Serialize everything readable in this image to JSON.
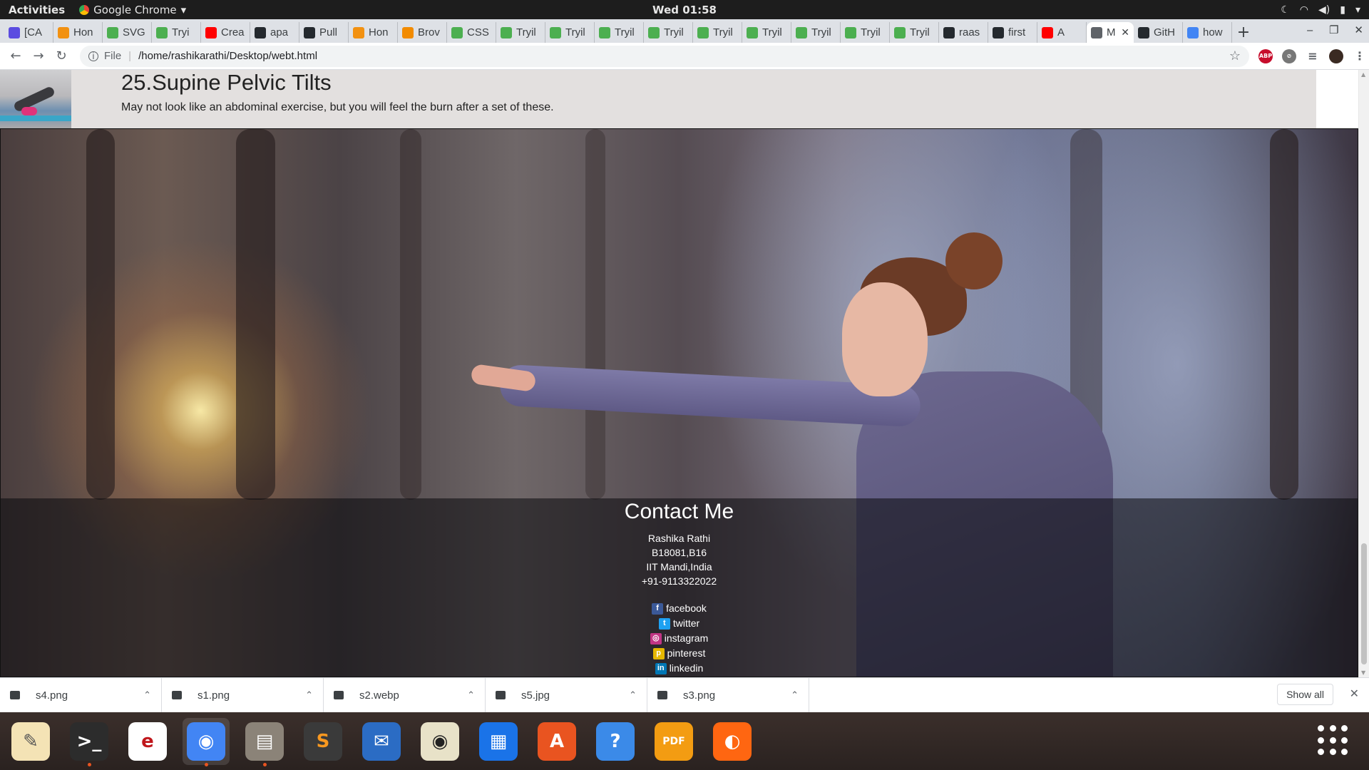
{
  "topbar": {
    "activities": "Activities",
    "app_name": "Google Chrome",
    "clock": "Wed 01:58"
  },
  "tabs": [
    {
      "label": "[CA",
      "favicon": "diamond-icon",
      "color": "#5b4ce0"
    },
    {
      "label": "Hon",
      "favicon": "swirl-icon",
      "color": "#f29111"
    },
    {
      "label": "SVG",
      "favicon": "w3schools-icon",
      "color": "#4caf50"
    },
    {
      "label": "Tryi",
      "favicon": "w3schools-icon",
      "color": "#4caf50"
    },
    {
      "label": "Crea",
      "favicon": "youtube-icon",
      "color": "#ff0000"
    },
    {
      "label": "apa",
      "favicon": "github-icon",
      "color": "#24292e"
    },
    {
      "label": "Pull",
      "favicon": "github-icon",
      "color": "#24292e"
    },
    {
      "label": "Hon",
      "favicon": "swirl-icon",
      "color": "#f29111"
    },
    {
      "label": "Brov",
      "favicon": "r-icon",
      "color": "#f28b00"
    },
    {
      "label": "CSS",
      "favicon": "w3schools-icon",
      "color": "#4caf50"
    },
    {
      "label": "Tryil",
      "favicon": "w3schools-icon",
      "color": "#4caf50"
    },
    {
      "label": "Tryil",
      "favicon": "w3schools-icon",
      "color": "#4caf50"
    },
    {
      "label": "Tryil",
      "favicon": "w3schools-icon",
      "color": "#4caf50"
    },
    {
      "label": "Tryil",
      "favicon": "w3schools-icon",
      "color": "#4caf50"
    },
    {
      "label": "Tryil",
      "favicon": "w3schools-icon",
      "color": "#4caf50"
    },
    {
      "label": "Tryil",
      "favicon": "w3schools-icon",
      "color": "#4caf50"
    },
    {
      "label": "Tryil",
      "favicon": "w3schools-icon",
      "color": "#4caf50"
    },
    {
      "label": "Tryil",
      "favicon": "w3schools-icon",
      "color": "#4caf50"
    },
    {
      "label": "Tryil",
      "favicon": "w3schools-icon",
      "color": "#4caf50"
    },
    {
      "label": "raas",
      "favicon": "github-icon",
      "color": "#24292e"
    },
    {
      "label": "first",
      "favicon": "github-icon",
      "color": "#24292e"
    },
    {
      "label": "A",
      "favicon": "youtube-icon",
      "color": "#ff0000"
    },
    {
      "label": "M",
      "favicon": "globe-icon",
      "color": "#5f6368",
      "active": true
    },
    {
      "label": "GitH",
      "favicon": "github-icon",
      "color": "#24292e"
    },
    {
      "label": "how",
      "favicon": "google-icon",
      "color": "#4285f4"
    }
  ],
  "addressbar": {
    "scheme": "File",
    "url": "/home/rashikarathi/Desktop/webt.html"
  },
  "exercise": {
    "title": "25.Supine Pelvic Tilts",
    "description": "May not look like an abdominal exercise, but you will feel the burn after a set of these."
  },
  "contact": {
    "heading": "Contact Me",
    "name": "Rashika Rathi",
    "id": "B18081,B16",
    "place": "IIT Mandi,India",
    "phone": "+91-9113322022",
    "social": [
      {
        "label": "facebook",
        "icon": "facebook-icon",
        "color": "#3b5998",
        "glyph": "f"
      },
      {
        "label": "twitter",
        "icon": "twitter-icon",
        "color": "#1da1f2",
        "glyph": "t"
      },
      {
        "label": "instagram",
        "icon": "instagram-icon",
        "color": "#c13584",
        "glyph": "◎"
      },
      {
        "label": "pinterest",
        "icon": "pinterest-icon",
        "color": "#e6b800",
        "glyph": "p"
      },
      {
        "label": "linkedin",
        "icon": "linkedin-icon",
        "color": "#0077b5",
        "glyph": "in"
      }
    ]
  },
  "downloads": {
    "files": [
      "s4.png",
      "s1.png",
      "s2.webp",
      "s5.jpg",
      "s3.png"
    ],
    "show_all": "Show all"
  },
  "dock": [
    {
      "name": "text-editor-icon",
      "color": "#f4e3b5",
      "glyph": "✎",
      "fg": "#555"
    },
    {
      "name": "terminal-icon",
      "color": "#2c2c2c",
      "glyph": ">_",
      "dot": true
    },
    {
      "name": "evince-icon",
      "color": "#ffffff",
      "glyph": "e",
      "fg": "#c0171c"
    },
    {
      "name": "chrome-icon",
      "color": "#4285f4",
      "glyph": "◉",
      "active": true,
      "dot": true
    },
    {
      "name": "files-icon",
      "color": "#8b8378",
      "glyph": "▤",
      "dot": true
    },
    {
      "name": "sublime-icon",
      "color": "#3a3a3a",
      "glyph": "S",
      "fg": "#f89820"
    },
    {
      "name": "thunderbird-icon",
      "color": "#2b6cc4",
      "glyph": "✉"
    },
    {
      "name": "rhythmbox-icon",
      "color": "#e8e2c8",
      "glyph": "◉",
      "fg": "#222"
    },
    {
      "name": "libreoffice-impress-icon",
      "color": "#1a73e8",
      "glyph": "▦"
    },
    {
      "name": "software-center-icon",
      "color": "#e95420",
      "glyph": "A"
    },
    {
      "name": "help-icon",
      "color": "#3b8ae8",
      "glyph": "?"
    },
    {
      "name": "pdf-editor-icon",
      "color": "#f39c12",
      "glyph": "PDF"
    },
    {
      "name": "firefox-icon",
      "color": "#ff6611",
      "glyph": "◐"
    }
  ]
}
